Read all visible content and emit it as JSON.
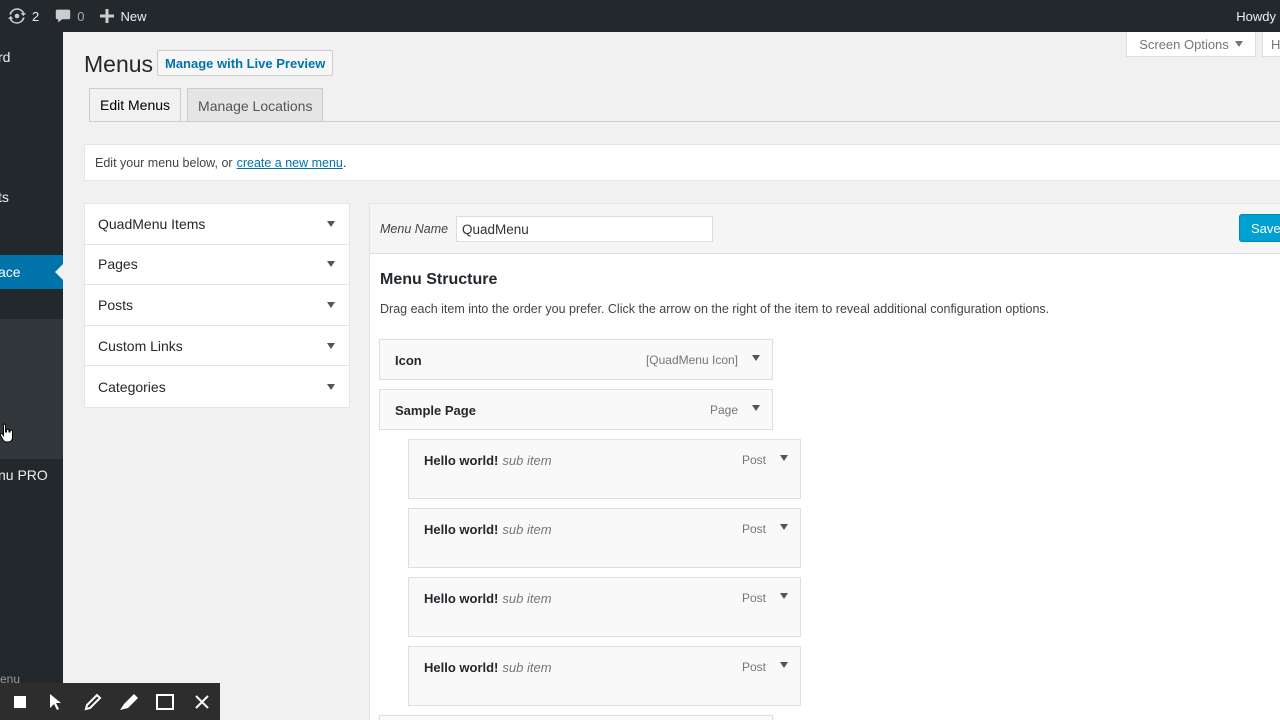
{
  "admin_bar": {
    "updates_count": "2",
    "comments_count": "0",
    "new_label": "New",
    "howdy": "Howdy"
  },
  "sidebar": {
    "items": [
      {
        "label": "rd"
      },
      {
        "label": "ts"
      },
      {
        "label": "ace"
      },
      {
        "label": "nu PRO"
      }
    ],
    "bottom_label": "menu"
  },
  "page": {
    "title": "Menus",
    "live_preview_button": "Manage with Live Preview",
    "screen_options": "Screen Options",
    "help_tab": "H"
  },
  "tabs": [
    {
      "label": "Edit Menus"
    },
    {
      "label": "Manage Locations"
    }
  ],
  "notice": {
    "text": "Edit your menu below, or",
    "link": "create a new menu",
    "suffix": "."
  },
  "accordion": [
    {
      "label": "QuadMenu Items"
    },
    {
      "label": "Pages"
    },
    {
      "label": "Posts"
    },
    {
      "label": "Custom Links"
    },
    {
      "label": "Categories"
    }
  ],
  "menu_editor": {
    "name_label": "Menu Name",
    "name_value": "QuadMenu",
    "save_label": "Save",
    "structure_title": "Menu Structure",
    "structure_desc": "Drag each item into the order you prefer. Click the arrow on the right of the item to reveal additional configuration options."
  },
  "menu_items": [
    {
      "title": "Icon",
      "sub": "",
      "type": "[QuadMenu Icon]"
    },
    {
      "title": "Sample Page",
      "sub": "",
      "type": "Page"
    },
    {
      "title": "Hello world!",
      "sub": "sub item",
      "type": "Post"
    },
    {
      "title": "Hello world!",
      "sub": "sub item",
      "type": "Post"
    },
    {
      "title": "Hello world!",
      "sub": "sub item",
      "type": "Post"
    },
    {
      "title": "Hello world!",
      "sub": "sub item",
      "type": "Post"
    }
  ],
  "colors": {
    "admin_bar": "#23282d",
    "accent": "#0073aa",
    "save_button": "#00a0d2"
  }
}
